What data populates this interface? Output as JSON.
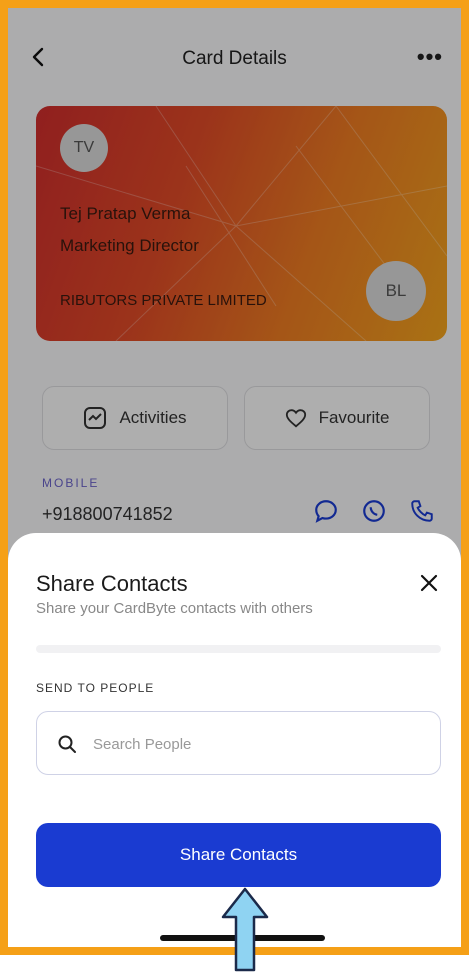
{
  "header": {
    "title": "Card Details"
  },
  "card": {
    "initials": "TV",
    "name": "Tej Pratap Verma",
    "role": "Marketing Director",
    "company": "RIBUTORS PRIVATE LIMITED",
    "badge": "BL"
  },
  "actions": {
    "activities": "Activities",
    "favourite": "Favourite"
  },
  "contact": {
    "mobile_label": "MOBILE",
    "mobile_value": "+918800741852"
  },
  "sheet": {
    "title": "Share Contacts",
    "subtitle": "Share your CardByte contacts with others",
    "send_label": "SEND TO PEOPLE",
    "search_placeholder": "Search People",
    "share_button": "Share Contacts"
  },
  "colors": {
    "frame": "#f5a017",
    "primary": "#1a3bd1",
    "arrow": "#8fd3f2"
  }
}
